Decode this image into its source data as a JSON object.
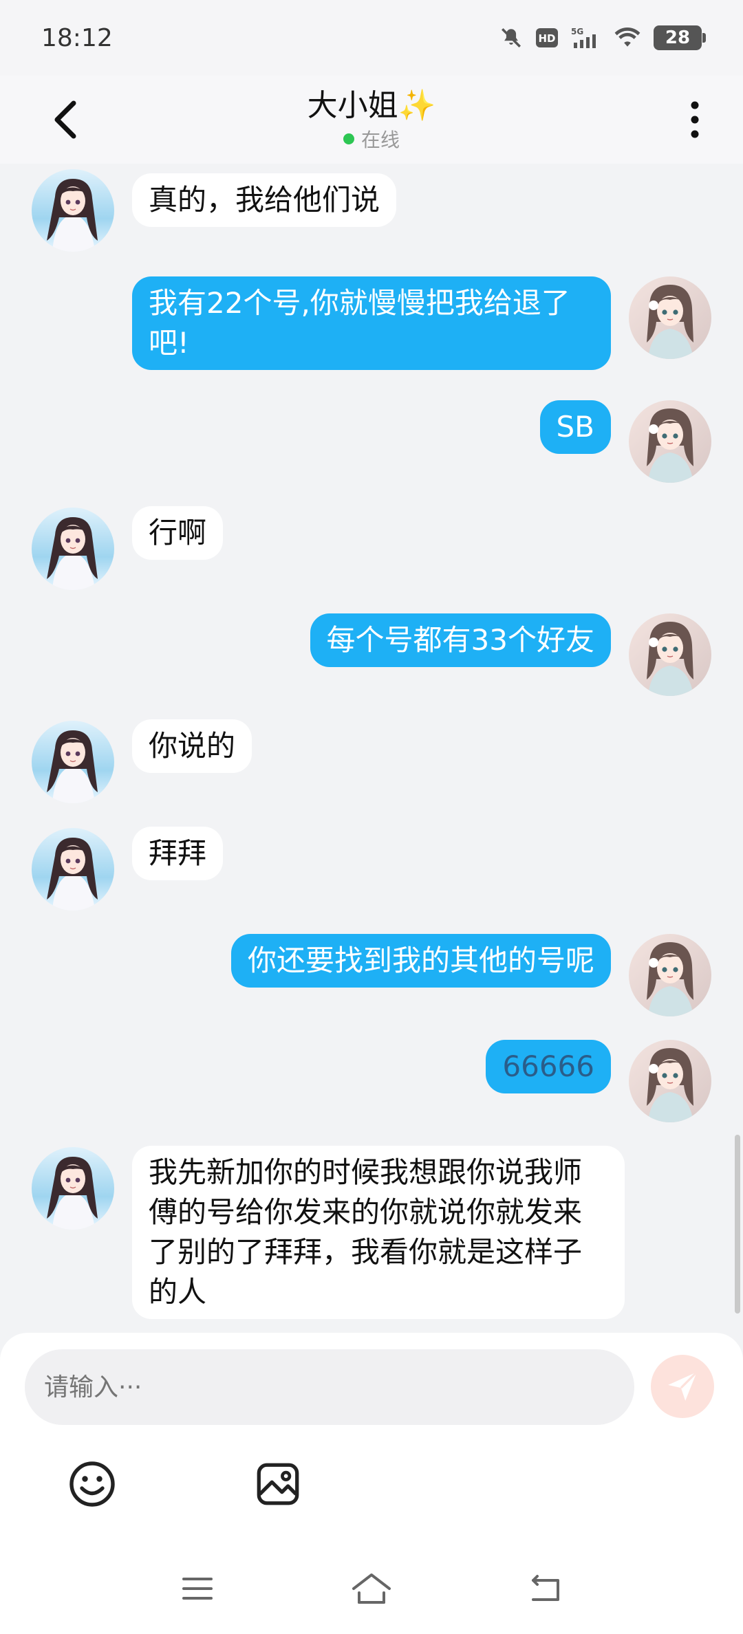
{
  "status_bar": {
    "time": "18:12",
    "battery": "28",
    "network": "5G"
  },
  "header": {
    "title": "大小姐",
    "title_emoji": "✨",
    "status": "在线"
  },
  "messages": [
    {
      "side": "left",
      "text": "真的，我给他们说"
    },
    {
      "side": "right",
      "text": "我有22个号,你就慢慢把我给退了吧!"
    },
    {
      "side": "right",
      "text": "SB"
    },
    {
      "side": "left",
      "text": "行啊"
    },
    {
      "side": "right",
      "text": "每个号都有33个好友"
    },
    {
      "side": "left",
      "text": "你说的"
    },
    {
      "side": "left",
      "text": "拜拜"
    },
    {
      "side": "right",
      "text": "你还要找到我的其他的号呢"
    },
    {
      "side": "right",
      "text": "66666"
    },
    {
      "side": "left",
      "text": "我先新加你的时候我想跟你说我师傅的号给你发来的你就说你就发来了别的了拜拜，我看你就是这样子的人"
    }
  ],
  "input": {
    "placeholder": "请输入···",
    "value": ""
  },
  "colors": {
    "outgoing_bubble": "#1eb0f5",
    "incoming_bubble": "#ffffff",
    "online_dot": "#2dc653",
    "send_button": "#fde2dc"
  },
  "icons": [
    "back-arrow-icon",
    "more-vert-icon",
    "emoji-icon",
    "image-icon",
    "send-icon",
    "menu-icon",
    "home-icon",
    "back-nav-icon"
  ]
}
